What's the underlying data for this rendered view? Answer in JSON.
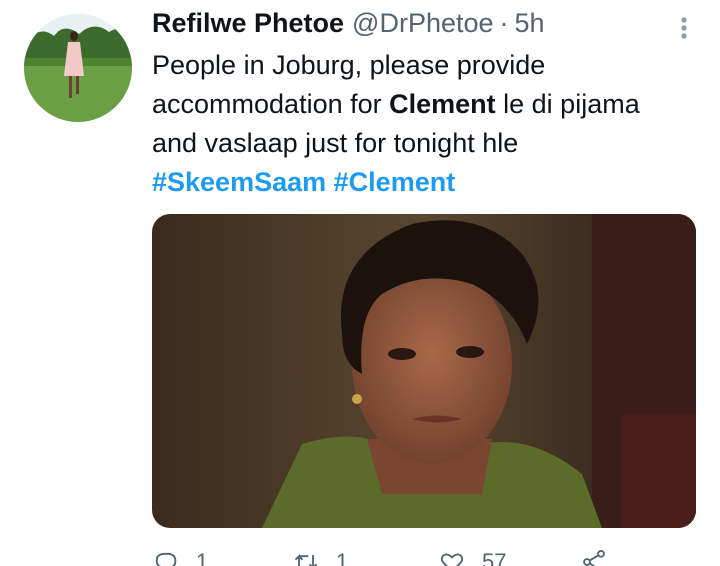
{
  "tweet": {
    "author_name": "Refilwe Phetoe",
    "handle": "@DrPhetoe",
    "separator": "·",
    "time": "5h",
    "text_line1": "People in Joburg, please provide",
    "text_line2_pre": "accommodation for ",
    "text_line2_bold": "Clement",
    "text_line2_post": " le di pijama",
    "text_line3": "and vaslaap just for tonight hle",
    "hashtag1": "#SkeemSaam",
    "hashtag2": "#Clement"
  },
  "actions": {
    "reply_count": "1",
    "retweet_count": "1",
    "like_count": "57"
  },
  "icons": {
    "more": "more-vertical-icon",
    "reply": "reply-icon",
    "retweet": "retweet-icon",
    "like": "heart-icon",
    "share": "share-icon"
  },
  "colors": {
    "accent": "#1d9bf0",
    "text": "#0f1419",
    "muted": "#536471"
  }
}
